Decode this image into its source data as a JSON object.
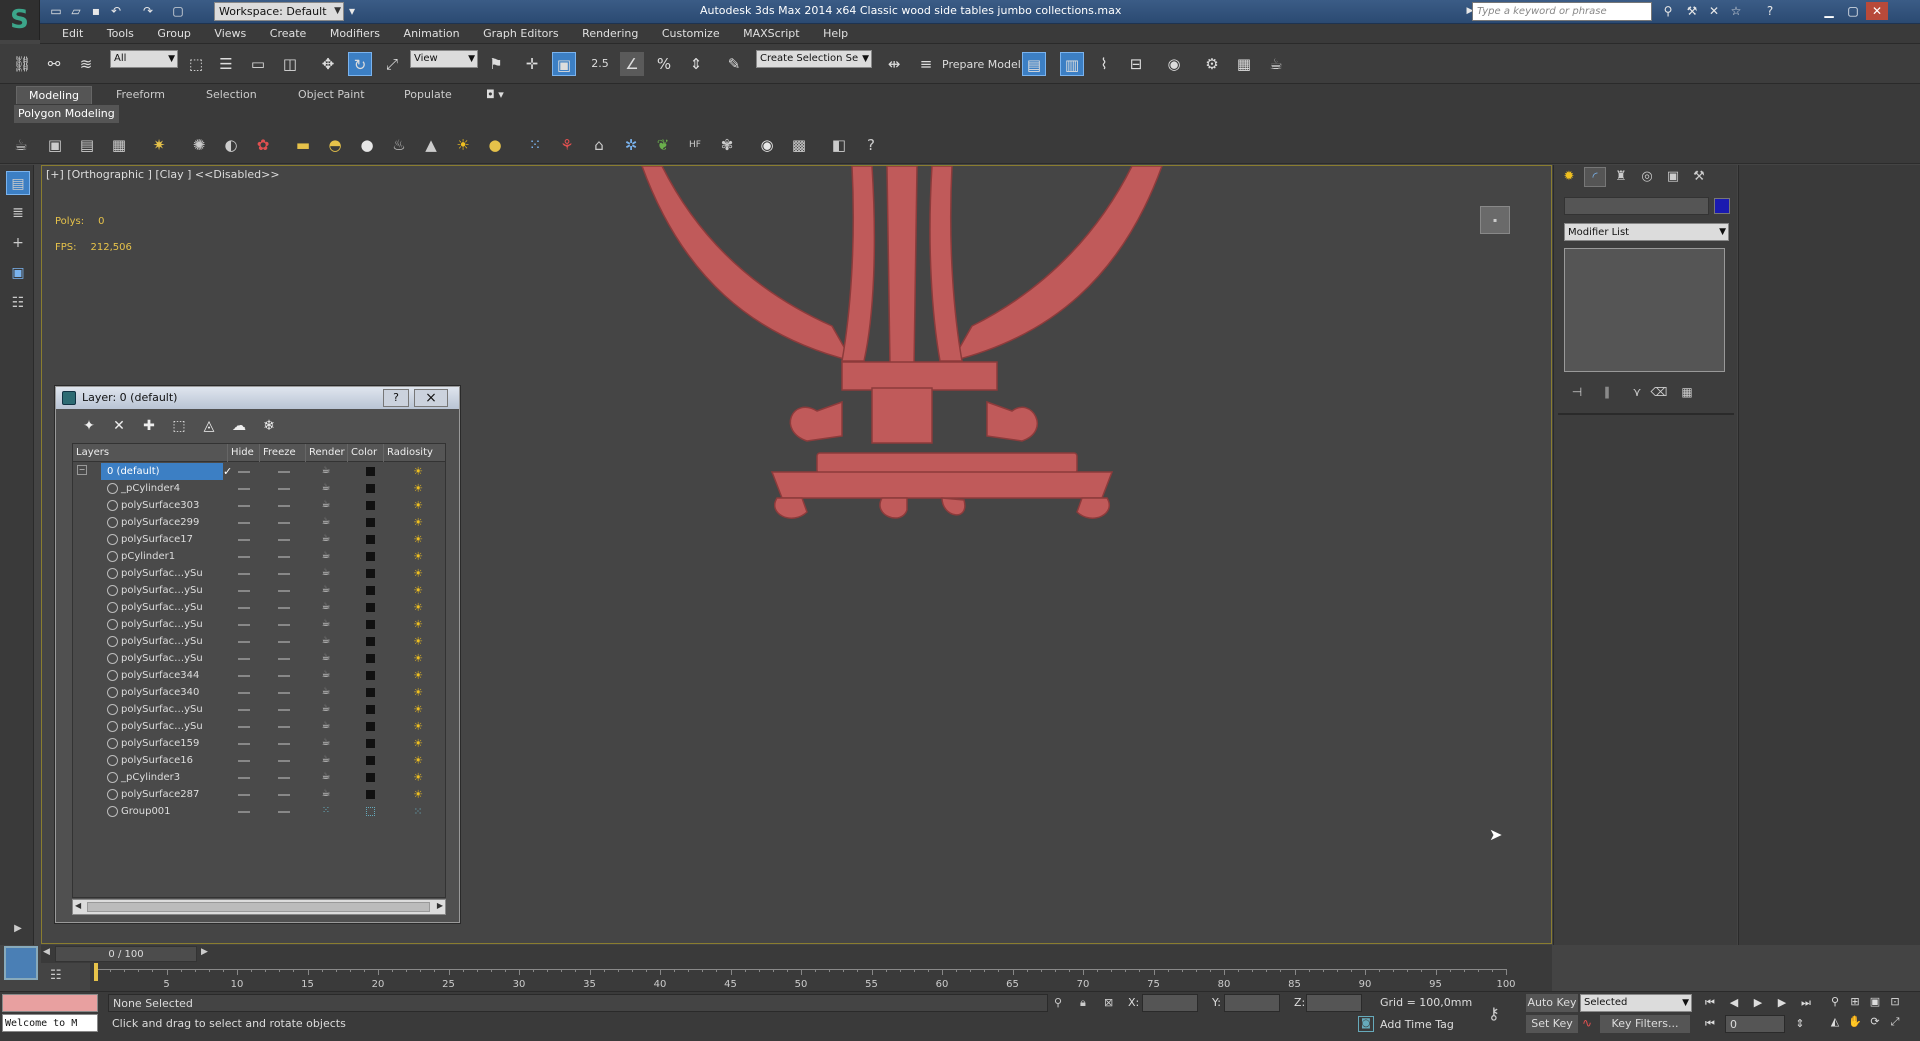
{
  "app": {
    "title": "Autodesk 3ds Max  2014 x64     Classic wood side tables  jumbo collections.max",
    "workspace": "Workspace: Default",
    "search_placeholder": "Type a keyword or phrase"
  },
  "menu": [
    "Edit",
    "Tools",
    "Group",
    "Views",
    "Create",
    "Modifiers",
    "Animation",
    "Graph Editors",
    "Rendering",
    "Customize",
    "MAXScript",
    "Help"
  ],
  "toolbar": {
    "filter_select": "All",
    "ref_coord_select": "View",
    "snap_label": "2.5",
    "named_selection": "Create Selection Se",
    "prepare_model": "Prepare Model"
  },
  "ribbon": {
    "tabs": [
      "Modeling",
      "Freeform",
      "Selection",
      "Object Paint",
      "Populate"
    ],
    "active_tab": "Modeling",
    "panel_label": "Polygon Modeling"
  },
  "viewport": {
    "label": "[+] [Orthographic ] [Clay ]  <<Disabled>>",
    "polys_label": "Polys:",
    "polys_value": "0",
    "fps_label": "FPS:",
    "fps_value": "212,506",
    "model_color": "#c05a5a"
  },
  "command_panel": {
    "modifier_list": "Modifier List",
    "object_color": "#1a1ab0"
  },
  "layer_dialog": {
    "title": "Layer: 0 (default)",
    "help": "?",
    "close": "×",
    "columns": [
      "Layers",
      "Hide",
      "Freeze",
      "Render",
      "Color",
      "Radiosity"
    ],
    "rows": [
      "0 (default)",
      "_pCylinder4",
      "polySurface303",
      "polySurface299",
      "polySurface17",
      "pCylinder1",
      "polySurfac…ySu",
      "polySurfac…ySu",
      "polySurfac…ySu",
      "polySurfac…ySu",
      "polySurfac…ySu",
      "polySurfac…ySu",
      "polySurface344",
      "polySurface340",
      "polySurfac…ySu",
      "polySurfac…ySu",
      "polySurface159",
      "polySurface16",
      "_pCylinder3",
      "polySurface287",
      "Group001"
    ]
  },
  "timeline": {
    "frame_counter": "0 / 100",
    "ticks": [
      "5",
      "10",
      "15",
      "20",
      "25",
      "30",
      "35",
      "40",
      "45",
      "50",
      "55",
      "60",
      "65",
      "70",
      "75",
      "80",
      "85",
      "90",
      "95",
      "100"
    ]
  },
  "status": {
    "maxscript": "Welcome to M",
    "selection": "None Selected",
    "prompt": "Click and drag to select and rotate objects",
    "x_label": "X:",
    "y_label": "Y:",
    "z_label": "Z:",
    "grid": "Grid = 100,0mm",
    "add_time_tag": "Add Time Tag",
    "auto_key": "Auto Key",
    "set_key": "Set Key",
    "selected": "Selected",
    "key_filters": "Key Filters...",
    "frame": "0"
  }
}
